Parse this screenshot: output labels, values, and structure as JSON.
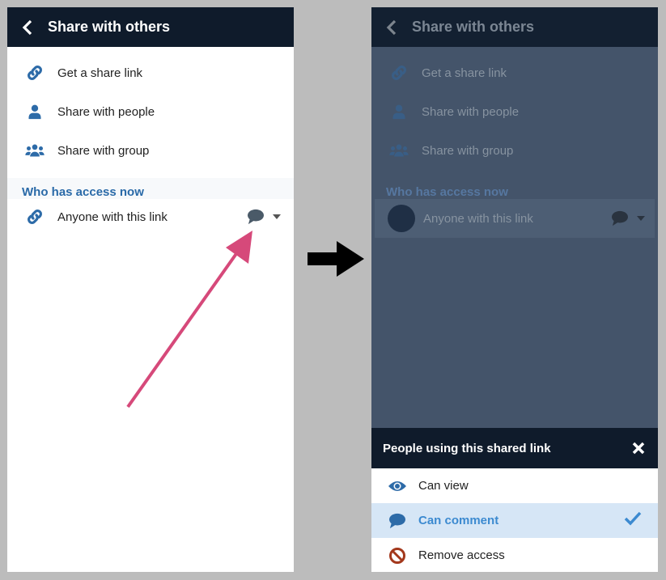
{
  "left_screen": {
    "header": {
      "title": "Share with others"
    },
    "menu": [
      {
        "label": "Get a share link",
        "icon": "link-icon"
      },
      {
        "label": "Share with people",
        "icon": "person-icon"
      },
      {
        "label": "Share with group",
        "icon": "group-icon"
      }
    ],
    "section_title": "Who has access now",
    "access_row": {
      "label": "Anyone with this link",
      "permission_icon": "comment-icon"
    }
  },
  "right_screen": {
    "header": {
      "title": "Share with others"
    },
    "menu": [
      {
        "label": "Get a share link"
      },
      {
        "label": "Share with people"
      },
      {
        "label": "Share with group"
      }
    ],
    "section_title": "Who has access now",
    "access_row": {
      "label": "Anyone with this link"
    },
    "sheet": {
      "title": "People using this shared link",
      "options": [
        {
          "label": "Can view",
          "icon": "eye-icon",
          "selected": false
        },
        {
          "label": "Can comment",
          "icon": "comment-icon",
          "selected": true
        },
        {
          "label": "Remove access",
          "icon": "ban-icon",
          "selected": false
        }
      ]
    }
  },
  "colors": {
    "header": "#0f1b2b",
    "accent": "#2a6aa8",
    "selected_bg": "#d6e6f6",
    "annotation_arrow": "#d6497a"
  }
}
